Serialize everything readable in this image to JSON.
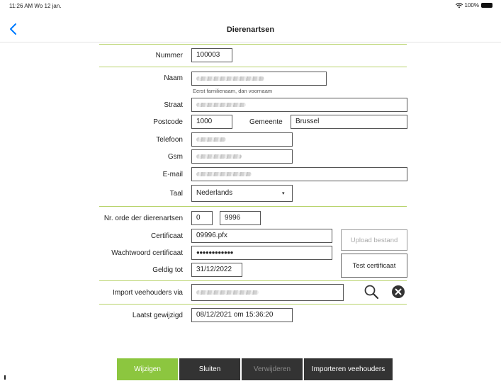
{
  "status_bar": {
    "time": "11:26 AM  Wo 12 jan.",
    "battery": "100%"
  },
  "nav": {
    "title": "Dierenartsen"
  },
  "form": {
    "nummer": {
      "label": "Nummer",
      "value": "100003"
    },
    "naam": {
      "label": "Naam",
      "hint": "Eerst familienaam, dan voornaam"
    },
    "straat": {
      "label": "Straat"
    },
    "postcode": {
      "label": "Postcode",
      "value": "1000"
    },
    "gemeente": {
      "label": "Gemeente",
      "value": "Brussel"
    },
    "telefoon": {
      "label": "Telefoon"
    },
    "gsm": {
      "label": "Gsm"
    },
    "email": {
      "label": "E-mail"
    },
    "taal": {
      "label": "Taal",
      "value": "Nederlands"
    },
    "nr_orde": {
      "label": "Nr. orde der dierenartsen",
      "value1": "0",
      "value2": "9996"
    },
    "certificaat": {
      "label": "Certificaat",
      "value": "09996.pfx"
    },
    "wachtwoord": {
      "label": "Wachtwoord certificaat",
      "value": "●●●●●●●●●●●●"
    },
    "geldig_tot": {
      "label": "Geldig tot",
      "value": "31/12/2022"
    },
    "upload_button": "Upload bestand",
    "test_button": "Test certificaat",
    "import_via": {
      "label": "Import veehouders via"
    },
    "laatst_gewijzigd": {
      "label": "Laatst gewijzigd",
      "value": "08/12/2021 om 15:36:20"
    }
  },
  "actions": {
    "wijzigen": "Wijzigen",
    "sluiten": "Sluiten",
    "verwijderen": "Verwijderen",
    "importeren": "Importeren veehouders"
  },
  "colors": {
    "accent_green": "#8cc63f",
    "separator": "#b8d36b",
    "dark_button": "#333333",
    "ios_blue": "#007aff"
  }
}
